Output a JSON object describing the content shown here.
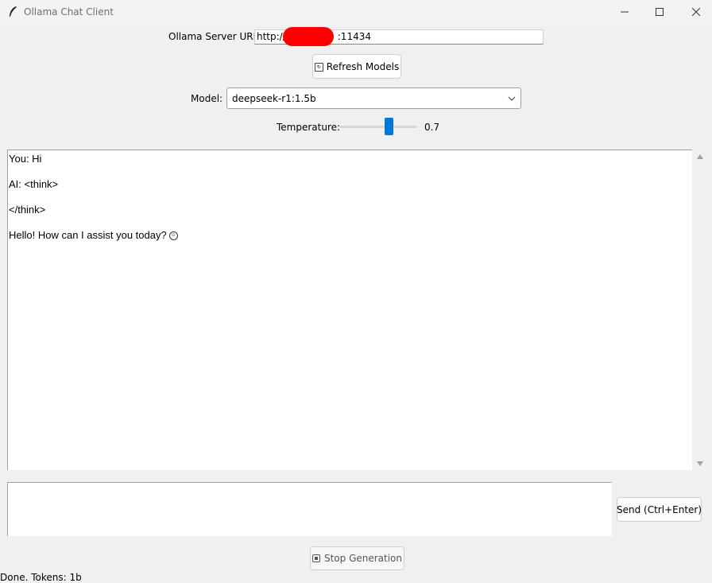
{
  "window": {
    "title": "Ollama Chat Client",
    "icon": "feather-icon",
    "controls": [
      "minimize-icon",
      "maximize-icon",
      "close-icon"
    ]
  },
  "server": {
    "label": "Ollama Server URL:",
    "url_prefix": "http://",
    "url_suffix": ":11434"
  },
  "refresh": {
    "icon": "refresh-icon",
    "label": "Refresh Models"
  },
  "model": {
    "label": "Model:",
    "selected": "deepseek-r1:1.5b"
  },
  "temperature": {
    "label": "Temperature:",
    "value": "0.7",
    "level": 0.7
  },
  "chat": {
    "lines": [
      "You: Hi",
      "AI: <think>",
      "</think>",
      "Hello! How can I assist you today?"
    ],
    "emoji_icon": "smiley-icon"
  },
  "input": {
    "value": ""
  },
  "send": {
    "label": "Send (Ctrl+Enter)"
  },
  "stop": {
    "icon": "stop-icon",
    "label": "Stop Generation"
  },
  "status": {
    "text": "Done. Tokens: 1b"
  },
  "colors": {
    "accent": "#0078d4",
    "redaction": "#ff0000",
    "background": "#f0f0f0"
  }
}
